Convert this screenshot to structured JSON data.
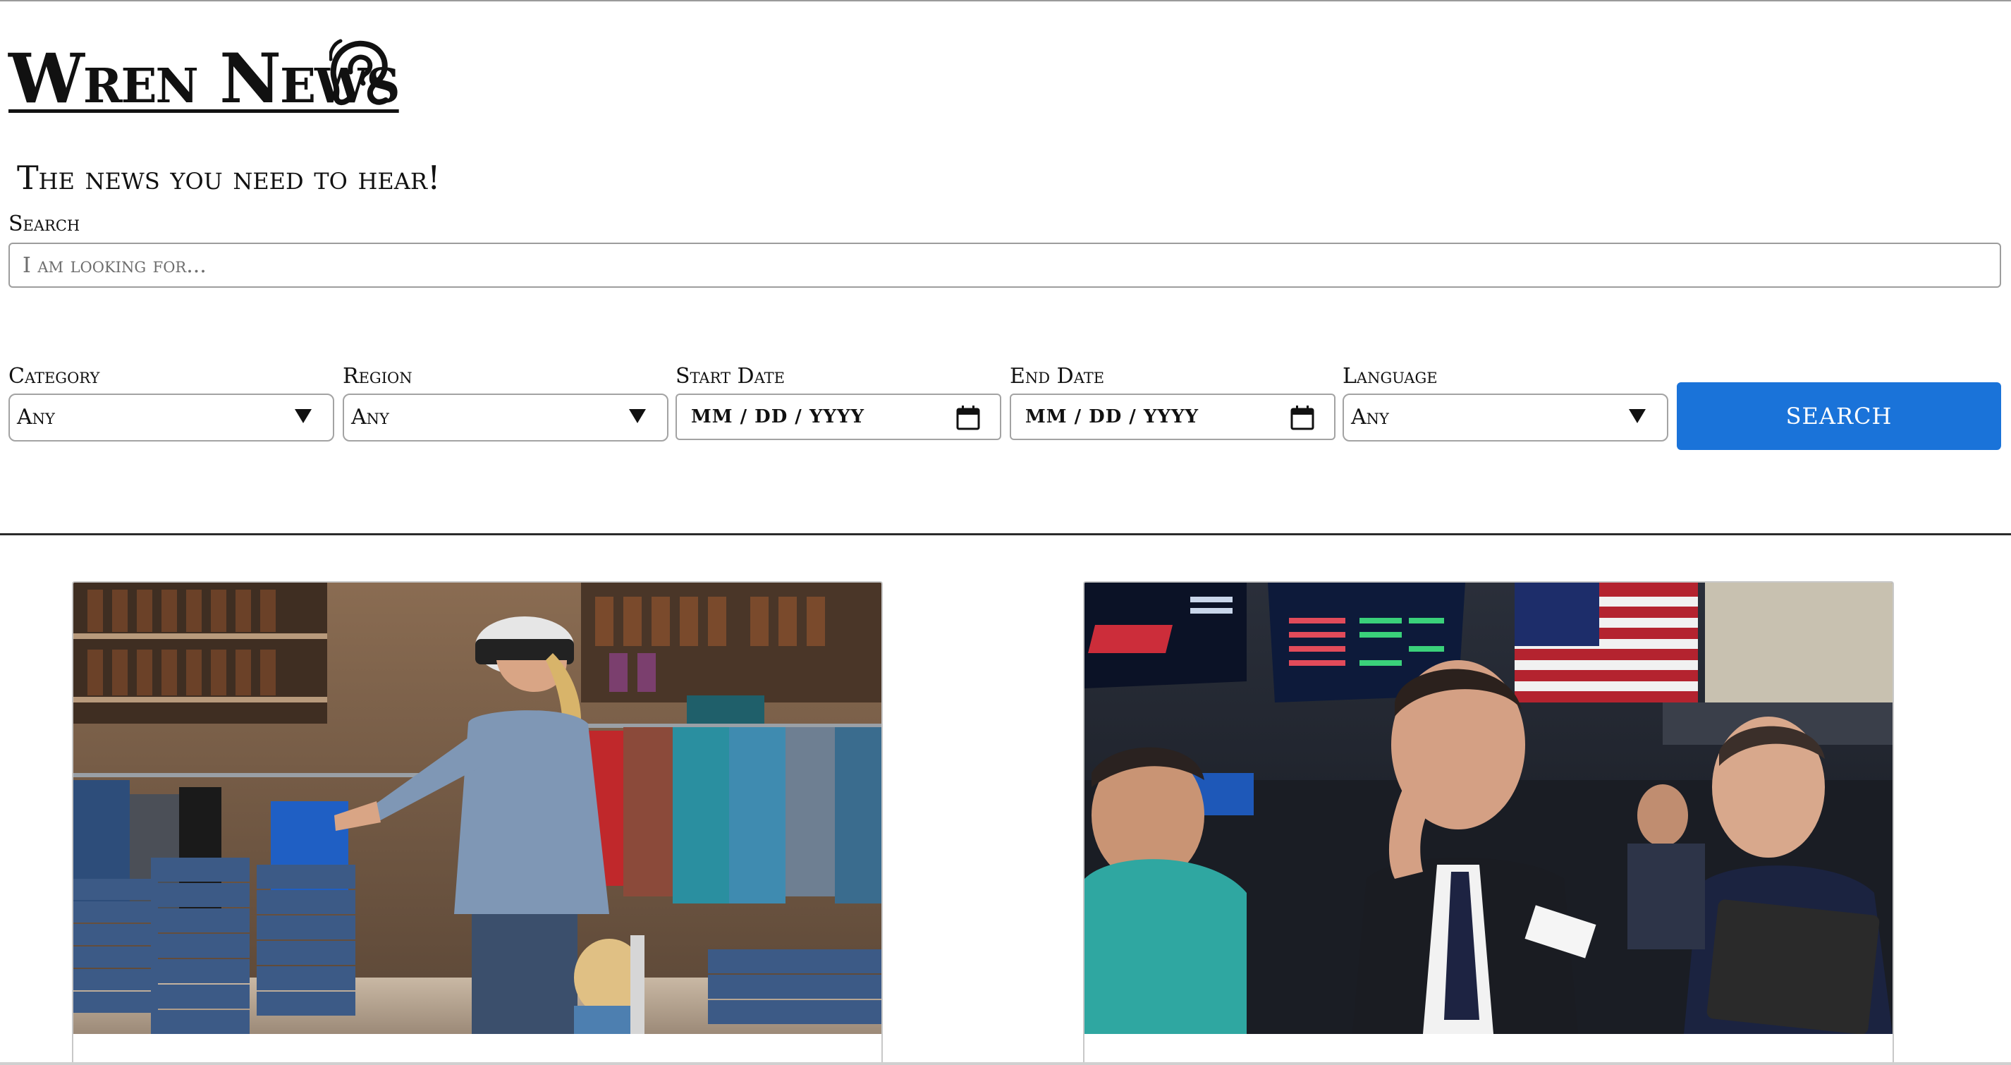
{
  "header": {
    "title": "Wren News",
    "tagline": "The news you need to hear!"
  },
  "search": {
    "label": "Search",
    "placeholder": "I am looking for..."
  },
  "filters": {
    "category": {
      "label": "Category",
      "value": "Any"
    },
    "region": {
      "label": "Region",
      "value": "Any"
    },
    "start_date": {
      "label": "Start Date",
      "value": "MM / DD / YYYY"
    },
    "end_date": {
      "label": "End Date",
      "value": "MM / DD / YYYY"
    },
    "language": {
      "label": "Language",
      "value": "Any"
    }
  },
  "search_button": {
    "label": "SEARCH"
  },
  "colors": {
    "accent": "#1a73d9",
    "text": "#111111",
    "border": "#a3a3a3"
  },
  "icons": {
    "logo": "ear-icon",
    "date": "calendar-icon",
    "dropdown": "caret-down-icon"
  },
  "articles": [
    {
      "image": "photo-western-wear-store-shopper-browsing-shirts"
    },
    {
      "image": "photo-stock-exchange-traders-watching-screens"
    }
  ]
}
